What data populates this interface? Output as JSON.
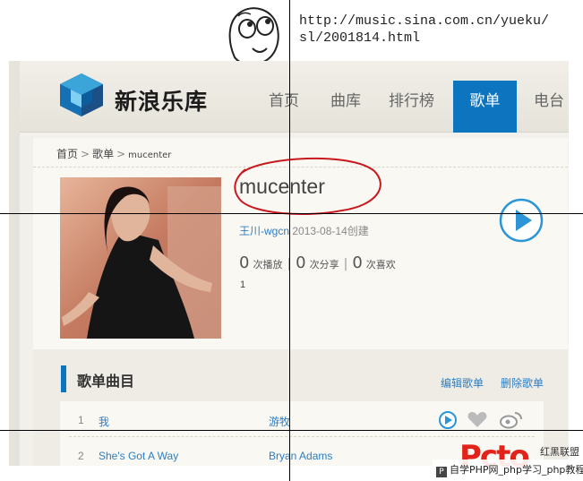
{
  "note": {
    "url": "http://music.sina.com.cn/yueku/sl/2001814.html"
  },
  "header": {
    "brand": "新浪乐库",
    "nav": [
      {
        "label": "首页",
        "active": false
      },
      {
        "label": "曲库",
        "active": false
      },
      {
        "label": "排行榜",
        "active": false
      },
      {
        "label": "歌单",
        "active": true
      },
      {
        "label": "电台",
        "active": false
      }
    ]
  },
  "breadcrumb": {
    "home": "首页",
    "sep1": ">",
    "section": "歌单",
    "sep2": ">",
    "current": "mucenter"
  },
  "playlist": {
    "title": "mucenter",
    "creator": "王川-wgcn",
    "created": "2013-08-14创建",
    "stats": {
      "plays": "0",
      "plays_label": "次播放",
      "shares": "0",
      "shares_label": "次分享",
      "likes": "0",
      "likes_label": "次喜欢"
    },
    "desc": "1"
  },
  "tracks_section": {
    "title": "歌单曲目",
    "edit_label": "编辑歌单",
    "delete_label": "删除歌单",
    "tracks": [
      {
        "index": "1",
        "name": "我",
        "artist": "游牧"
      },
      {
        "index": "2",
        "name": "She's Got A Way",
        "artist": "Bryan Adams"
      }
    ]
  },
  "watermark": {
    "logo": "Pcto",
    "tag": "红黑联盟",
    "strip": "自学PHP网_php学习_php教程"
  },
  "colors": {
    "accent": "#0d74c0",
    "link": "#2c7ec2",
    "annotation": "#c8191e"
  }
}
